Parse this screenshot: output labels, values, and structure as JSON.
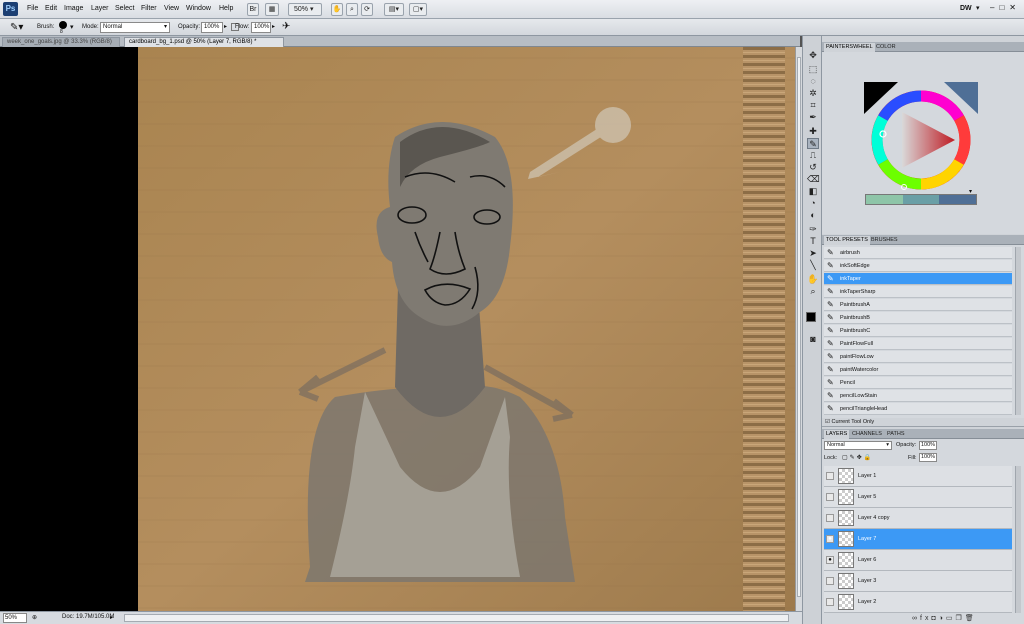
{
  "app": {
    "logo": "Ps"
  },
  "menubar": {
    "items": [
      "File",
      "Edit",
      "Image",
      "Layer",
      "Select",
      "Filter",
      "View",
      "Window",
      "Help"
    ],
    "zoom": "50%",
    "workspace": "DW"
  },
  "options": {
    "brush_label": "Brush:",
    "brush_size": "8",
    "mode_label": "Mode:",
    "mode_value": "Normal",
    "opacity_label": "Opacity:",
    "opacity_value": "100%",
    "flow_label": "Flow:",
    "flow_value": "100%"
  },
  "documents": {
    "tabs": [
      {
        "label": "week_one_goals.jpg @ 33.3% (RGB/8)",
        "active": false
      },
      {
        "label": "cardboard_bg_1.psd @ 50% (Layer 7, RGB/8) *",
        "active": true
      }
    ]
  },
  "status": {
    "zoom": "50%",
    "doc": "Doc: 19.7M/105.0M"
  },
  "colorpanel": {
    "tabs": [
      "PAINTERSWHEEL",
      "COLOR"
    ],
    "swatches": [
      "#8ec5a8",
      "#6a9fa6",
      "#4f6f96"
    ]
  },
  "presets": {
    "tabs": [
      "TOOL PRESETS",
      "BRUSHES"
    ],
    "items": [
      "airbrush",
      "inkSoftEdge",
      "inkTaper",
      "inkTaperSharp",
      "PaintbrushA",
      "PaintbrushB",
      "PaintbrushC",
      "PaintFlowFull",
      "paintFlowLow",
      "paintWatercolor",
      "Pencil",
      "pencilLowStain",
      "pencilTriangleHead"
    ],
    "selected_index": 2,
    "current_tool_only": "Current Tool Only"
  },
  "layers": {
    "tabs": [
      "LAYERS",
      "CHANNELS",
      "PATHS"
    ],
    "blend_mode": "Normal",
    "opacity_label": "Opacity:",
    "opacity_value": "100%",
    "lock_label": "Lock:",
    "fill_label": "Fill:",
    "fill_value": "100%",
    "items": [
      {
        "name": "Layer 1",
        "visible": false
      },
      {
        "name": "Layer 5",
        "visible": false
      },
      {
        "name": "Layer 4 copy",
        "visible": false
      },
      {
        "name": "Layer 7",
        "visible": true
      },
      {
        "name": "Layer 6",
        "visible": true
      },
      {
        "name": "Layer 3",
        "visible": false
      },
      {
        "name": "Layer 2",
        "visible": false
      }
    ],
    "selected_index": 3
  },
  "colors": {
    "selection": "#3c99f5",
    "foreground": "#000000",
    "background": "#ffffff",
    "cardboard": "#b08a5a"
  }
}
